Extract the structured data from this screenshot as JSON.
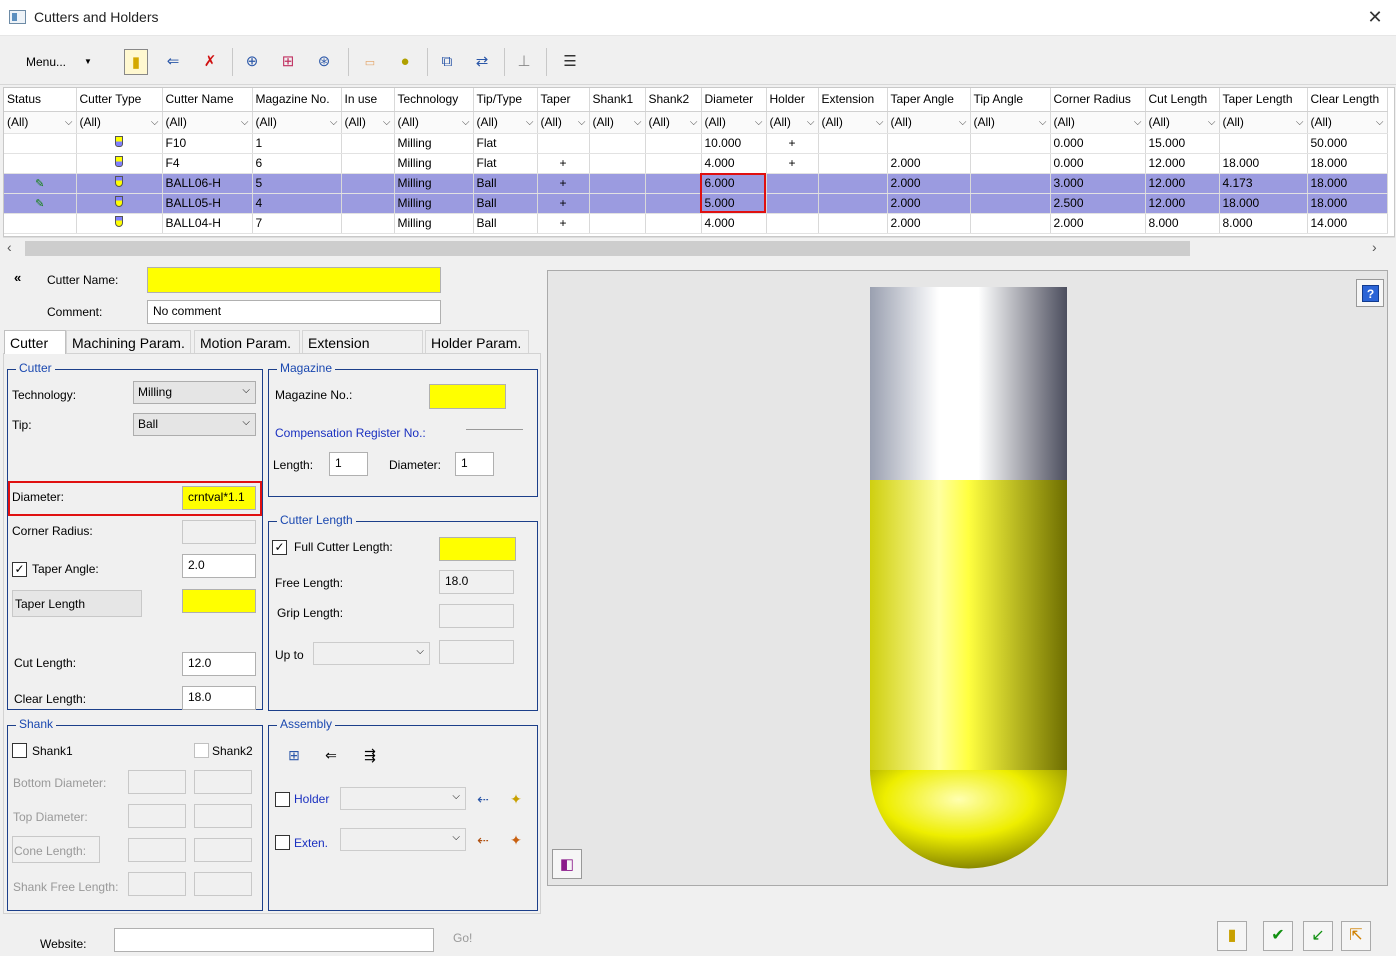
{
  "window": {
    "title": "Cutters and Holders",
    "close_glyph": "✕"
  },
  "toolbar": {
    "menu_label": "Menu...",
    "buttons": [
      "new-cutter-icon",
      "import-cutter-icon",
      "delete-cutter-icon",
      "add-cutter-icon",
      "add-multi-cutter-icon",
      "add-holder-icon",
      "notes-icon",
      "add-circle-icon",
      "copy-cutter-icon",
      "swap-cutter-icon",
      "clear-filter-icon",
      "settings-icon"
    ]
  },
  "grid": {
    "columns": [
      "Status",
      "Cutter Type",
      "Cutter Name",
      "Magazine No.",
      "In use",
      "Technology",
      "Tip/Type",
      "Taper",
      "Shank1",
      "Shank2",
      "Diameter",
      "Holder",
      "Extension",
      "Taper Angle",
      "Tip Angle",
      "Corner Radius",
      "Cut Length",
      "Taper Length",
      "Clear Length"
    ],
    "filter_value": "(All)",
    "rows": [
      {
        "status": "",
        "type": "flat",
        "name": "F10",
        "mag": "1",
        "inuse": "",
        "tech": "Milling",
        "tip": "Flat",
        "taper": "",
        "shank1": "",
        "shank2": "",
        "diameter": "10.000",
        "holder": "+",
        "extension": "",
        "taper_angle": "",
        "tip_angle": "",
        "corner_radius": "0.000",
        "cut_length": "15.000",
        "taper_length": "",
        "clear_length": "50.000",
        "selected": false
      },
      {
        "status": "",
        "type": "flat",
        "name": "F4",
        "mag": "6",
        "inuse": "",
        "tech": "Milling",
        "tip": "Flat",
        "taper": "+",
        "shank1": "",
        "shank2": "",
        "diameter": "4.000",
        "holder": "+",
        "extension": "",
        "taper_angle": "2.000",
        "tip_angle": "",
        "corner_radius": "0.000",
        "cut_length": "12.000",
        "taper_length": "18.000",
        "clear_length": "18.000",
        "selected": false
      },
      {
        "status": "edit",
        "type": "ball",
        "name": "BALL06-H",
        "mag": "5",
        "inuse": "",
        "tech": "Milling",
        "tip": "Ball",
        "taper": "+",
        "shank1": "",
        "shank2": "",
        "diameter": "6.000",
        "holder": "",
        "extension": "",
        "taper_angle": "2.000",
        "tip_angle": "",
        "corner_radius": "3.000",
        "cut_length": "12.000",
        "taper_length": "4.173",
        "clear_length": "18.000",
        "selected": true
      },
      {
        "status": "edit",
        "type": "ball",
        "name": "BALL05-H",
        "mag": "4",
        "inuse": "",
        "tech": "Milling",
        "tip": "Ball",
        "taper": "+",
        "shank1": "",
        "shank2": "",
        "diameter": "5.000",
        "holder": "",
        "extension": "",
        "taper_angle": "2.000",
        "tip_angle": "",
        "corner_radius": "2.500",
        "cut_length": "12.000",
        "taper_length": "18.000",
        "clear_length": "18.000",
        "selected": true
      },
      {
        "status": "",
        "type": "ball",
        "name": "BALL04-H",
        "mag": "7",
        "inuse": "",
        "tech": "Milling",
        "tip": "Ball",
        "taper": "+",
        "shank1": "",
        "shank2": "",
        "diameter": "4.000",
        "holder": "",
        "extension": "",
        "taper_angle": "2.000",
        "tip_angle": "",
        "corner_radius": "2.000",
        "cut_length": "8.000",
        "taper_length": "8.000",
        "clear_length": "14.000",
        "selected": false
      }
    ]
  },
  "form": {
    "collapse_glyph": "«",
    "cutter_name_label": "Cutter Name:",
    "cutter_name_value": "",
    "comment_label": "Comment:",
    "comment_value": "No comment",
    "tabs": [
      "Cutter",
      "Machining Param.",
      "Motion Param.",
      "Extension Param.",
      "Holder Param."
    ],
    "cutter_group": {
      "title": "Cutter",
      "technology_label": "Technology:",
      "technology_value": "Milling",
      "tip_label": "Tip:",
      "tip_value": "Ball",
      "diameter_label": "Diameter:",
      "diameter_value": "crntval*1.1",
      "corner_radius_label": "Corner Radius:",
      "corner_radius_value": "",
      "taper_angle_label": "Taper Angle:",
      "taper_angle_value": "2.0",
      "taper_angle_checked": true,
      "taper_length_label": "Taper Length",
      "taper_length_value": "",
      "cut_length_label": "Cut Length:",
      "cut_length_value": "12.0",
      "clear_length_label": "Clear Length:",
      "clear_length_value": "18.0"
    },
    "magazine_group": {
      "title": "Magazine",
      "mag_label": "Magazine No.:",
      "mag_value": "",
      "comp_label": "Compensation Register No.:",
      "length_label": "Length:",
      "length_value": "1",
      "diameter_label": "Diameter:",
      "diameter_value": "1"
    },
    "cutter_length_group": {
      "title": "Cutter Length",
      "full_label": "Full Cutter Length:",
      "full_value": "",
      "full_checked": true,
      "free_label": "Free Length:",
      "free_value": "18.0",
      "grip_label": "Grip Length:",
      "grip_value": "",
      "upto_label": "Up to",
      "upto_value": "",
      "upto_input": ""
    },
    "shank_group": {
      "title": "Shank",
      "shank1_label": "Shank1",
      "shank2_label": "Shank2",
      "bottom_label": "Bottom Diameter:",
      "top_label": "Top Diameter:",
      "cone_label": "Cone Length:",
      "free_label": "Shank Free Length:"
    },
    "assembly_group": {
      "title": "Assembly",
      "holder_label": "Holder",
      "holder_value": "",
      "exten_label": "Exten.",
      "exten_value": ""
    },
    "website_label": "Website:",
    "website_value": "",
    "go_label": "Go!"
  },
  "preview": {
    "help_glyph": "?",
    "view_icon": "view-cube-icon"
  },
  "footer": {
    "buttons": [
      "cutter-icon",
      "ok-check-icon",
      "apply-check-icon",
      "export-icon"
    ]
  },
  "colors": {
    "highlight_yellow": "#ffff00",
    "selected_row": "#9b9be0",
    "group_border": "#1c3f8a",
    "group_title": "#1a48b0",
    "red_highlight": "#e01010"
  }
}
